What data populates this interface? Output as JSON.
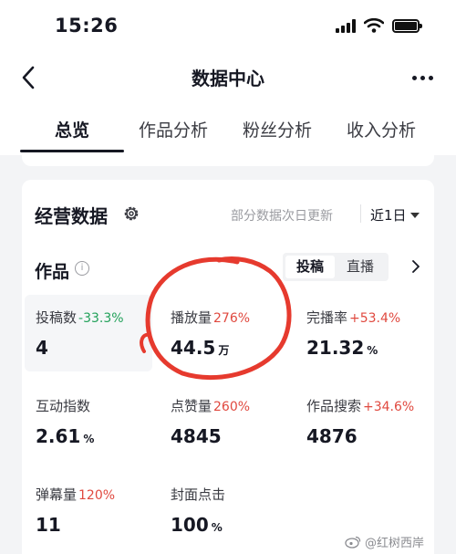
{
  "status_bar": {
    "time": "15:26"
  },
  "nav": {
    "title": "数据中心"
  },
  "tabs": [
    {
      "label": "总览"
    },
    {
      "label": "作品分析"
    },
    {
      "label": "粉丝分析"
    },
    {
      "label": "收入分析"
    }
  ],
  "section": {
    "title": "经营数据",
    "update_note": "部分数据次日更新",
    "range": "近1日"
  },
  "works": {
    "label": "作品",
    "segments": [
      {
        "label": "投稿"
      },
      {
        "label": "直播"
      }
    ]
  },
  "metrics": [
    {
      "label": "投稿数",
      "delta": "-33.3%",
      "value": "4",
      "unit": ""
    },
    {
      "label": "播放量",
      "delta": "276%",
      "value": "44.5",
      "unit": "万"
    },
    {
      "label": "完播率",
      "delta": "+53.4%",
      "value": "21.32",
      "unit": "%"
    },
    {
      "label": "互动指数",
      "delta": "",
      "value": "2.61",
      "unit": "%"
    },
    {
      "label": "点赞量",
      "delta": "260%",
      "value": "4845",
      "unit": ""
    },
    {
      "label": "作品搜索",
      "delta": "+34.6%",
      "value": "4876",
      "unit": ""
    },
    {
      "label": "弹幕量",
      "delta": "120%",
      "value": "11",
      "unit": ""
    },
    {
      "label": "封面点击",
      "delta": "",
      "value": "100",
      "unit": "%"
    }
  ],
  "colors": {
    "delta_up": "#e0493f",
    "delta_down": "#22a15a",
    "annotation": "#e63a2e"
  },
  "watermark": "@红树西岸"
}
